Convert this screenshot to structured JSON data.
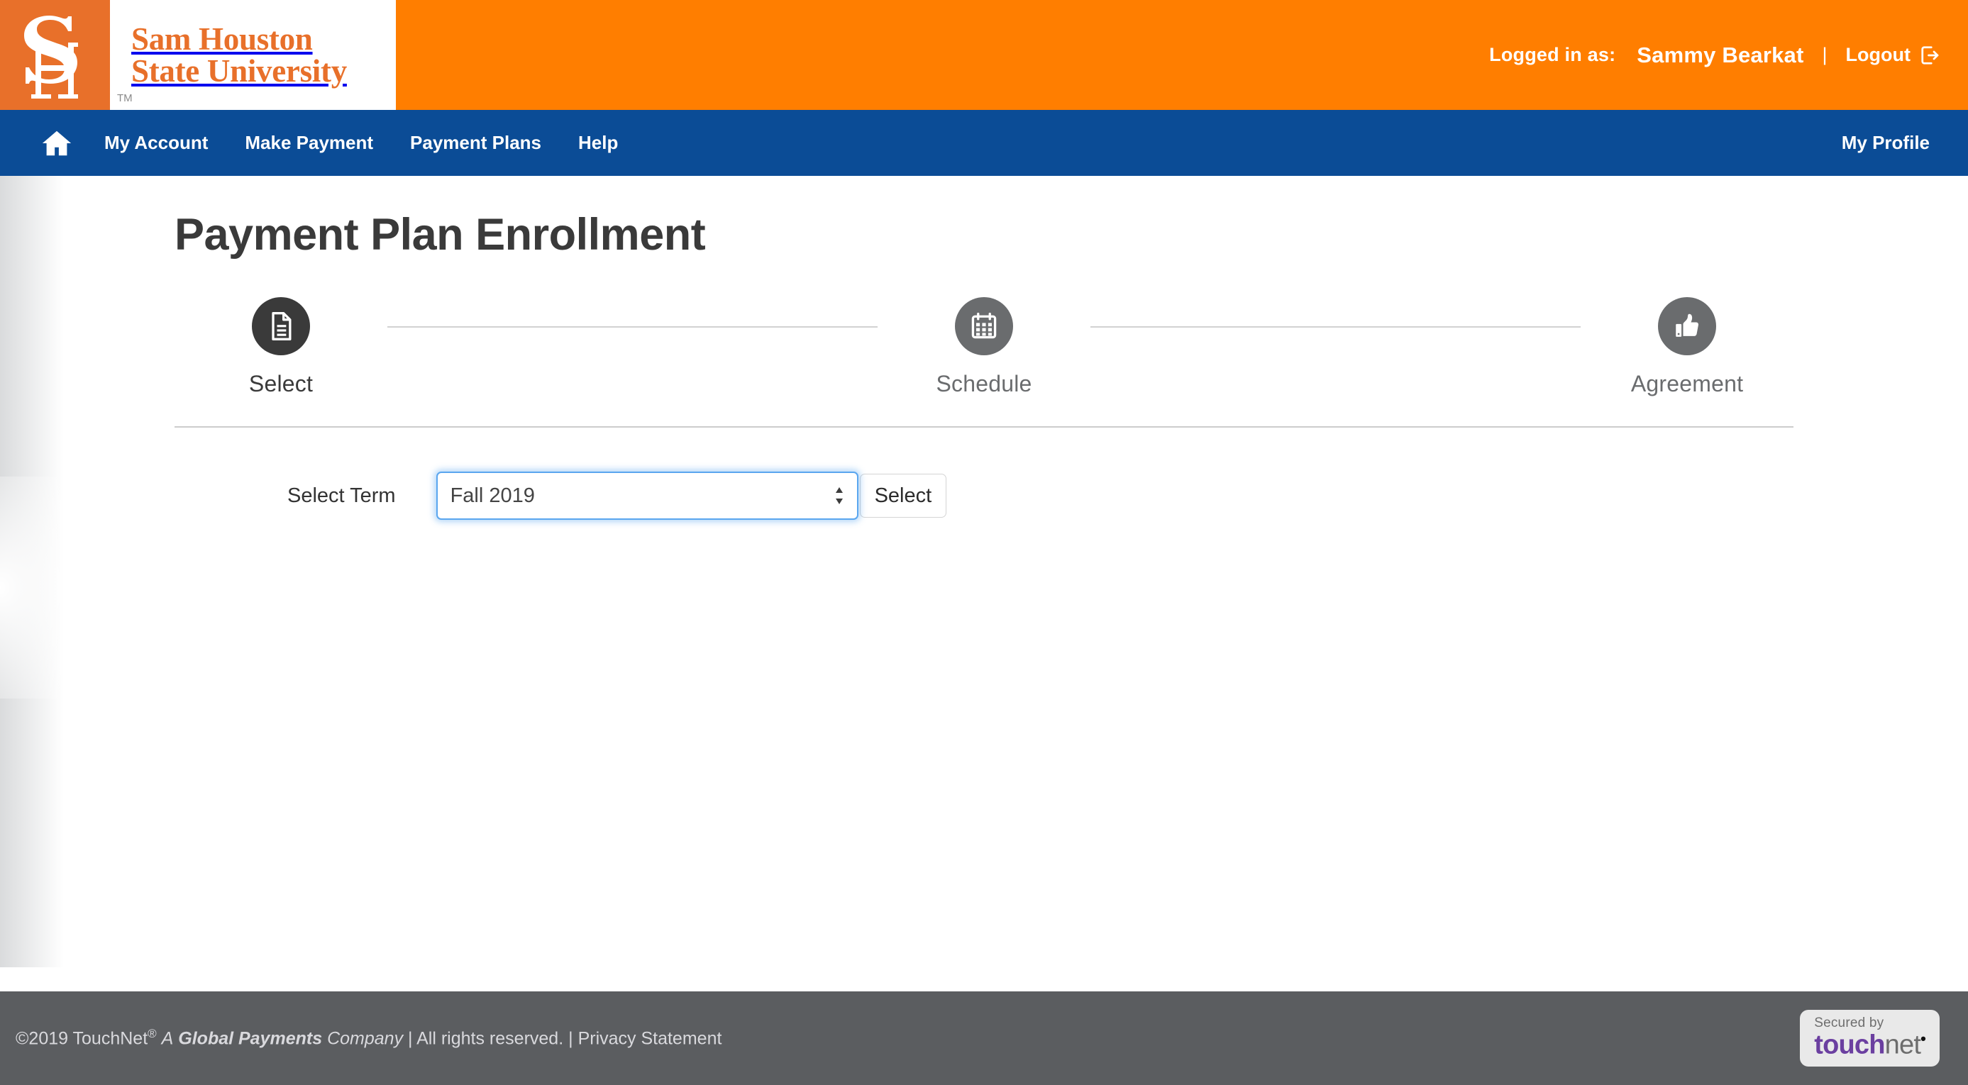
{
  "masthead": {
    "logo": {
      "mark_alt": "SH monogram",
      "line1": "Sam Houston",
      "line2": "State University",
      "tm": "TM"
    },
    "logged_in_label": "Logged in as:",
    "user_name": "Sammy Bearkat",
    "separator": "|",
    "logout_label": "Logout",
    "brand_orange": "#FF7E00"
  },
  "nav": {
    "home_label": "Home",
    "items": [
      {
        "label": "My Account"
      },
      {
        "label": "Make Payment"
      },
      {
        "label": "Payment Plans"
      },
      {
        "label": "Help"
      }
    ],
    "profile_label": "My Profile",
    "nav_blue": "#0B4C96"
  },
  "main": {
    "page_title": "Payment Plan Enrollment",
    "steps": [
      {
        "label": "Select",
        "icon": "document-icon",
        "state": "active"
      },
      {
        "label": "Schedule",
        "icon": "calendar-icon",
        "state": "inactive"
      },
      {
        "label": "Agreement",
        "icon": "thumbs-up-icon",
        "state": "inactive"
      }
    ],
    "form": {
      "term_label": "Select Term",
      "term_value": "Fall 2019",
      "term_options": [
        "Fall 2019"
      ],
      "select_button_label": "Select"
    }
  },
  "footer": {
    "copyright": "©2019 TouchNet",
    "registered_mark": "®",
    "a_text": "A",
    "global_payments": "Global Payments",
    "company": "Company",
    "sep1": "|",
    "rights": "All rights reserved.",
    "sep2": "|",
    "privacy": "Privacy Statement",
    "badge": {
      "secured_by": "Secured by",
      "brand_bold": "touch",
      "brand_light": "net",
      "dot": "•"
    },
    "footer_gray": "#5B5D60"
  }
}
